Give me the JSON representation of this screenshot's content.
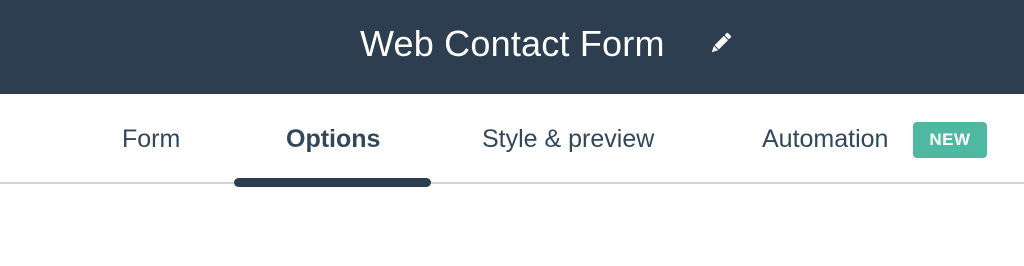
{
  "header": {
    "title": "Web Contact Form",
    "edit_icon": "pencil-icon",
    "background_color": "#2d3e50"
  },
  "tabs": [
    {
      "label": "Form",
      "active": false
    },
    {
      "label": "Options",
      "active": true
    },
    {
      "label": "Style & preview",
      "active": false
    },
    {
      "label": "Automation",
      "active": false,
      "badge": "NEW"
    }
  ],
  "colors": {
    "badge": "#4fb8a0",
    "tab_text": "#33475b",
    "active_indicator": "#2d3e50",
    "divider": "#cbd6e2"
  }
}
